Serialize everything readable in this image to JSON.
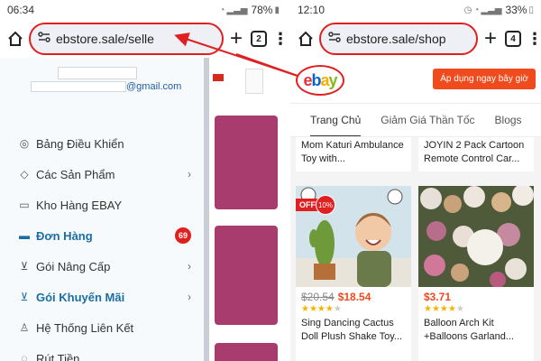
{
  "left": {
    "status": {
      "time": "06:34",
      "battery": "78%"
    },
    "url": "ebstore.sale/selle",
    "tab_count": "2",
    "drawer": {
      "email_suffix": "@gmail.com",
      "items": [
        {
          "icon": "dashboard-icon",
          "glyph": "◎",
          "label": "Bảng Điều Khiển",
          "chevron": false,
          "badge": "",
          "active": false
        },
        {
          "icon": "products-icon",
          "glyph": "◇",
          "label": "Các Sản Phẩm",
          "chevron": true,
          "badge": "",
          "active": false
        },
        {
          "icon": "warehouse-icon",
          "glyph": "▭",
          "label": "Kho Hàng EBAY",
          "chevron": false,
          "badge": "",
          "active": false
        },
        {
          "icon": "orders-icon",
          "glyph": "▬",
          "label": "Đơn Hàng",
          "chevron": false,
          "badge": "69",
          "active": true
        },
        {
          "icon": "cart-icon",
          "glyph": "⊻",
          "label": "Gói Nâng Cấp",
          "chevron": true,
          "badge": "",
          "active": false
        },
        {
          "icon": "promo-icon",
          "glyph": "⊻",
          "label": "Gói Khuyến Mãi",
          "chevron": true,
          "badge": "",
          "active": true
        },
        {
          "icon": "affiliate-icon",
          "glyph": "♙",
          "label": "Hệ Thống Liên Kết",
          "chevron": false,
          "badge": "",
          "active": false
        },
        {
          "icon": "withdraw-icon",
          "glyph": "◌",
          "label": "Rút Tiền",
          "chevron": false,
          "badge": "",
          "active": false
        }
      ]
    }
  },
  "right": {
    "status": {
      "time": "12:10",
      "battery": "33%"
    },
    "url": "ebstore.sale/shop",
    "tab_count": "4",
    "apply_button": "Áp dụng ngay bây giờ",
    "tabs": [
      "Trang Chủ",
      "Giảm Giá Thần Tốc",
      "Blogs"
    ],
    "products_top": [
      {
        "title": "Mom Katuri Ambulance Toy with..."
      },
      {
        "title": "JOYIN 2 Pack Cartoon Remote Control Car..."
      }
    ],
    "products": [
      {
        "old_price": "$20.54",
        "price": "$18.54",
        "title": "Sing Dancing Cactus Doll Plush Shake Toy...",
        "rating": 4,
        "badge": "OFF",
        "pct": "10%"
      },
      {
        "old_price": "",
        "price": "$3.71",
        "title": "Balloon Arch Kit +Balloons Garland...",
        "rating": 4,
        "badge": "",
        "pct": ""
      }
    ]
  },
  "colors": {
    "highlight": "#e02020",
    "accent": "#f04a1d",
    "drawer_active": "#1b6ea3"
  }
}
